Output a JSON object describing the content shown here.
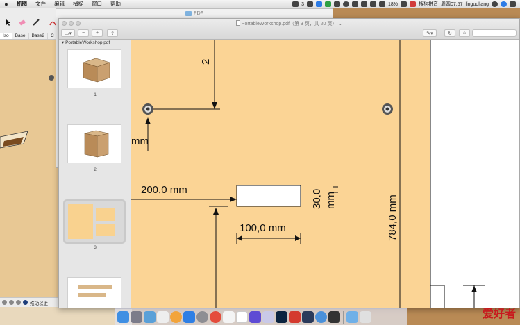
{
  "menubar": {
    "apple_icon": "apple-logo-icon",
    "items": [
      "抓图",
      "文件",
      "编辑",
      "捕捉",
      "窗口",
      "帮助"
    ],
    "status": {
      "badge_count": "3",
      "battery": "18%",
      "input_method": "搜狗拼音",
      "clock": "周四07:57",
      "user": "linguoliang"
    }
  },
  "background_app": {
    "tabs": [
      "Iso",
      "Base",
      "Base2",
      "C"
    ],
    "status_text": "拖动以进"
  },
  "finder_window": {
    "title": "PDF"
  },
  "preview": {
    "title": "PortableWorkshop.pdf（第 3 页，共 20 页）",
    "sidebar_file": "PortableWorkshop.pdf",
    "thumbnails": [
      {
        "label": "1"
      },
      {
        "label": "2"
      },
      {
        "label": "3",
        "selected": true
      },
      {
        "label": ""
      }
    ]
  },
  "drawing": {
    "background_color": "#fbd495",
    "labels": {
      "dim_200": "200,0 mm",
      "dim_100": "100,0 mm",
      "dim_30": "30,0",
      "dim_30_unit": "mm",
      "dim_784": "784,0 mm",
      "mm_left": "mm",
      "frag_top": "2",
      "frag_bottom": "nm"
    }
  },
  "dock": {
    "watermark": "爱好者",
    "icons": [
      "finder-icon",
      "rocket-icon",
      "photos-icon",
      "launchpad-icon",
      "safari-icon",
      "appstore-icon",
      "preferences-icon",
      "chrome-icon",
      "music-icon",
      "calendar-icon",
      "star-icon",
      "feather-icon",
      "photoshop-icon",
      "stack-icon",
      "mail-icon",
      "preview-icon",
      "terminal-icon",
      "folder-icon",
      "trash-icon"
    ]
  }
}
